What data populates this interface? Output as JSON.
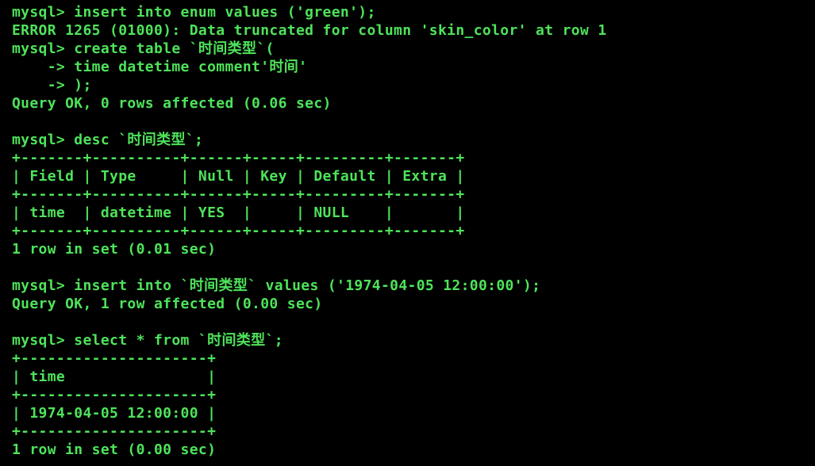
{
  "terminal": {
    "lines": [
      "mysql> insert into enum values ('green');",
      "ERROR 1265 (01000): Data truncated for column 'skin_color' at row 1",
      "mysql> create table `时间类型`(",
      "    -> time datetime comment'时间'",
      "    -> );",
      "Query OK, 0 rows affected (0.06 sec)",
      "",
      "mysql> desc `时间类型`;",
      "+-------+----------+------+-----+---------+-------+",
      "| Field | Type     | Null | Key | Default | Extra |",
      "+-------+----------+------+-----+---------+-------+",
      "| time  | datetime | YES  |     | NULL    |       |",
      "+-------+----------+------+-----+---------+-------+",
      "1 row in set (0.01 sec)",
      "",
      "mysql> insert into `时间类型` values ('1974-04-05 12:00:00');",
      "Query OK, 1 row affected (0.00 sec)",
      "",
      "mysql> select * from `时间类型`;",
      "+---------------------+",
      "| time                |",
      "+---------------------+",
      "| 1974-04-05 12:00:00 |",
      "+---------------------+",
      "1 row in set (0.00 sec)"
    ]
  },
  "colors": {
    "background": "#000000",
    "text": "#4ee35a"
  }
}
